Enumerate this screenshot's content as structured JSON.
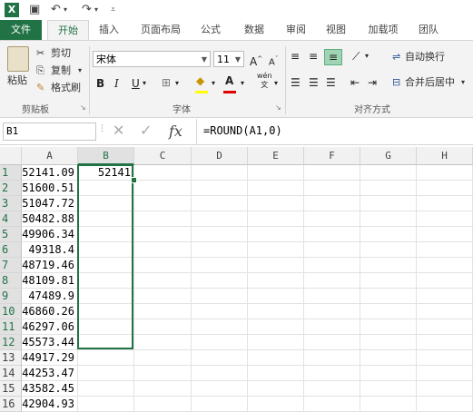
{
  "app": {
    "logo_letter": "X"
  },
  "ribbon_tabs": [
    "文件",
    "开始",
    "插入",
    "页面布局",
    "公式",
    "数据",
    "审阅",
    "视图",
    "加载项",
    "团队"
  ],
  "clipboard": {
    "paste": "粘贴",
    "cut": "剪切",
    "copy": "复制",
    "format_painter": "格式刷",
    "group_label": "剪贴板"
  },
  "font": {
    "name": "宋体",
    "size": "11",
    "bold": "B",
    "italic": "I",
    "underline": "U",
    "wen": "wén",
    "group_label": "字体"
  },
  "alignment": {
    "wrap_text": "自动换行",
    "merge_center": "合并后居中",
    "group_label": "对齐方式"
  },
  "formula_bar": {
    "name_box": "B1",
    "fx": "fx",
    "formula": "=ROUND(A1,0)"
  },
  "columns": [
    "A",
    "B",
    "C",
    "D",
    "E",
    "F",
    "G",
    "H"
  ],
  "rows": [
    "1",
    "2",
    "3",
    "4",
    "5",
    "6",
    "7",
    "8",
    "9",
    "10",
    "11",
    "12",
    "13",
    "14",
    "15",
    "16"
  ],
  "column_a_values": [
    "52141.09",
    "51600.51",
    "51047.72",
    "50482.88",
    "49906.34",
    "49318.4",
    "48719.46",
    "48109.81",
    "47489.9",
    "46860.26",
    "46297.06",
    "45573.44",
    "44917.29",
    "44253.47",
    "43582.45",
    "42904.93"
  ],
  "b1_value": "52141",
  "accent_color": "#217346"
}
